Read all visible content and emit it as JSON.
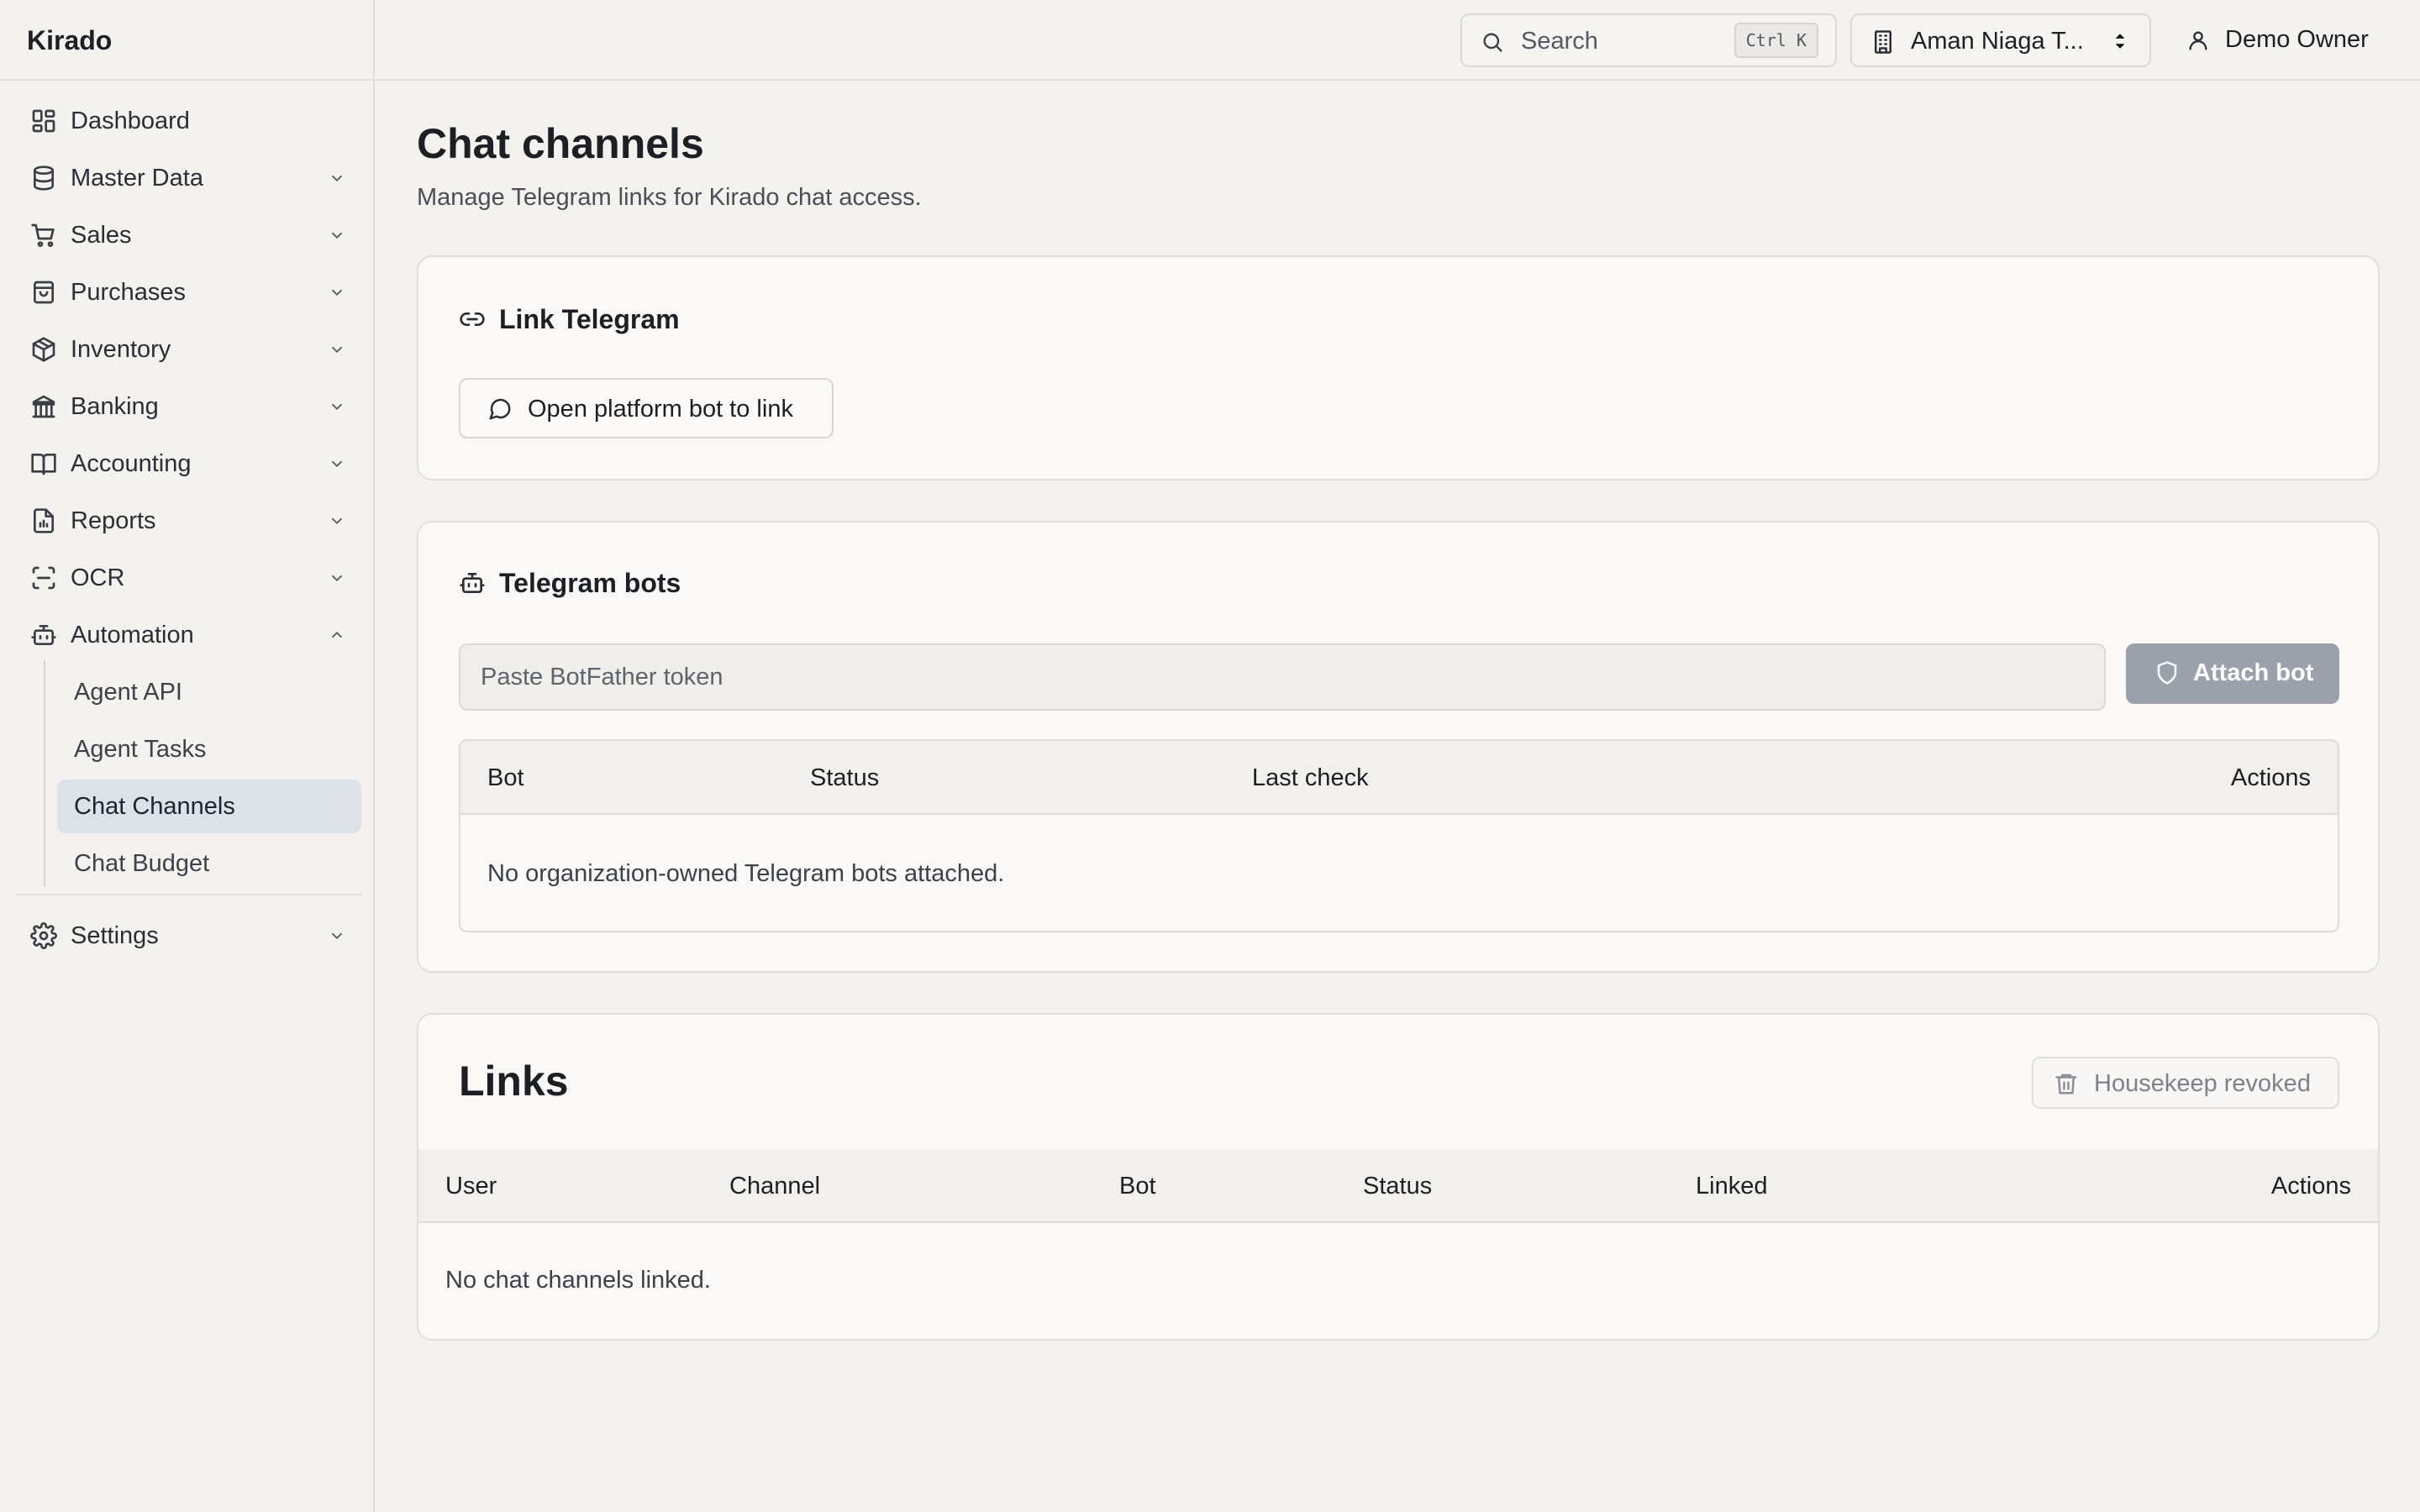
{
  "app": {
    "name": "Kirado"
  },
  "sidebar": {
    "items": [
      {
        "label": "Dashboard",
        "icon": "dashboard-icon"
      },
      {
        "label": "Master Data",
        "icon": "database-icon"
      },
      {
        "label": "Sales",
        "icon": "cart-icon"
      },
      {
        "label": "Purchases",
        "icon": "shopping-bag-icon"
      },
      {
        "label": "Inventory",
        "icon": "package-icon"
      },
      {
        "label": "Banking",
        "icon": "bank-icon"
      },
      {
        "label": "Accounting",
        "icon": "book-icon"
      },
      {
        "label": "Reports",
        "icon": "report-icon"
      },
      {
        "label": "OCR",
        "icon": "scan-icon"
      },
      {
        "label": "Automation",
        "icon": "bot-icon",
        "expanded": true
      }
    ],
    "automation_children": [
      {
        "label": "Agent API"
      },
      {
        "label": "Agent Tasks"
      },
      {
        "label": "Chat Channels",
        "active": true
      },
      {
        "label": "Chat Budget"
      }
    ],
    "settings": {
      "label": "Settings",
      "icon": "gear-icon"
    }
  },
  "topbar": {
    "search": {
      "label": "Search",
      "shortcut": "Ctrl K"
    },
    "org": {
      "name": "Aman Niaga T..."
    },
    "user": {
      "name": "Demo Owner"
    }
  },
  "page": {
    "title": "Chat channels",
    "subtitle": "Manage Telegram links for Kirado chat access."
  },
  "link_telegram": {
    "title": "Link Telegram",
    "button_label": "Open platform bot to link"
  },
  "telegram_bots": {
    "title": "Telegram bots",
    "token_placeholder": "Paste BotFather token",
    "attach_label": "Attach bot",
    "columns": [
      "Bot",
      "Status",
      "Last check",
      "Actions"
    ],
    "empty_text": "No organization-owned Telegram bots attached."
  },
  "links": {
    "title": "Links",
    "housekeep_label": "Housekeep revoked",
    "columns": [
      "User",
      "Channel",
      "Bot",
      "Status",
      "Linked",
      "Actions"
    ],
    "empty_text": "No chat channels linked."
  },
  "colors": {
    "background": "#f3f2ef",
    "card": "#faf9f7",
    "active_nav": "#dde1e8",
    "disabled_button": "#9aa1ab"
  }
}
